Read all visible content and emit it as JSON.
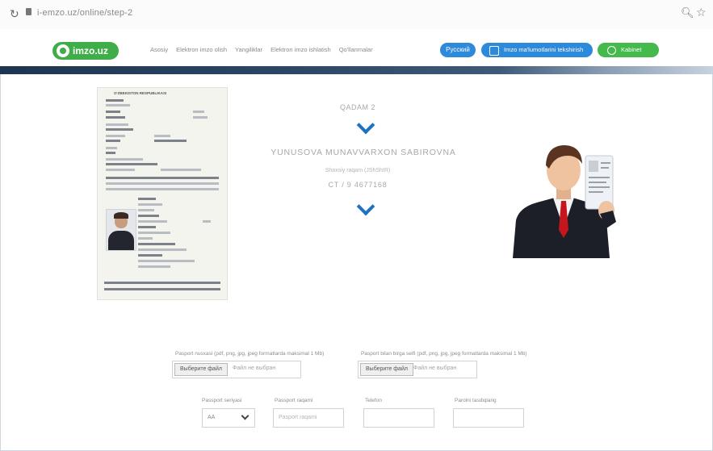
{
  "browser": {
    "url": "i-emzo.uz/online/step-2"
  },
  "header": {
    "logo_text": "imzo.uz",
    "nav": [
      "Asosiy",
      "Elektron imzo olish",
      "Yangiliklar",
      "Elektron imzo ishlatish",
      "Qo'llanmalar"
    ],
    "lang_button": "Русский",
    "sign_button": "Imzo ma'lumotlarini tekshirish",
    "login_button": "Kabinet"
  },
  "passport": {
    "title": "O'ZBEKISTON RESPUBLIKASI"
  },
  "center": {
    "step_label": "QADAM 2",
    "full_name": "YUNUSOVA MUNAVVARXON SABIROVNA",
    "sub_label": "Shaxsiy raqam (JShShIR)",
    "pinfl": "CT / 9 4677168"
  },
  "uploads": [
    {
      "label": "Pasport nusxasi (pdf, png, jpg, jpeg formatlarda maksimal 1 Mb)",
      "button": "Выберите файл",
      "file": "Файл не выбран"
    },
    {
      "label": "Pasport bilan birga selfi (pdf, png, jpg, jpeg formatlarda maksimal 1 Mb)",
      "button": "Выберите файл",
      "file": "Файл не выбран"
    }
  ],
  "fields": [
    {
      "label": "Passport seriyasi",
      "value": "AA",
      "type": "select"
    },
    {
      "label": "Passport raqami",
      "value": "Pasport raqami",
      "type": "input"
    },
    {
      "label": "Telefon",
      "value": "",
      "type": "input"
    },
    {
      "label": "Parolni tasdiqlang",
      "value": "",
      "type": "input"
    }
  ]
}
